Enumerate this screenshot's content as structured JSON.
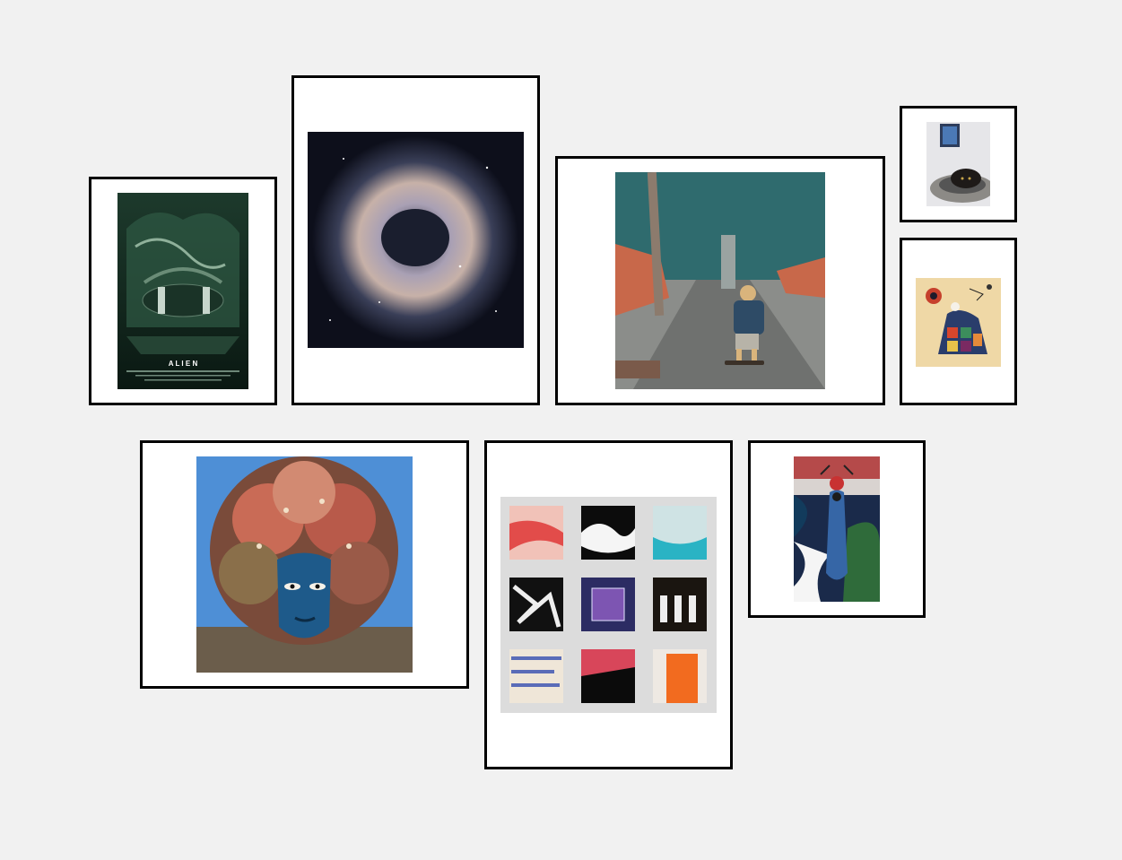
{
  "gallery": {
    "frames": [
      {
        "id": "alien-poster",
        "title_text": "A L I E N"
      },
      {
        "id": "rosette-nebula"
      },
      {
        "id": "boy-skateboard-hill"
      },
      {
        "id": "cat-bed-photo"
      },
      {
        "id": "abstract-figures-painting"
      },
      {
        "id": "flower-hair-mural"
      },
      {
        "id": "abstract-tiles-grid"
      },
      {
        "id": "figure-illustration"
      }
    ]
  },
  "colors": {
    "page_background": "#f1f1f1",
    "frame_border": "#000000",
    "mat": "#ffffff"
  }
}
